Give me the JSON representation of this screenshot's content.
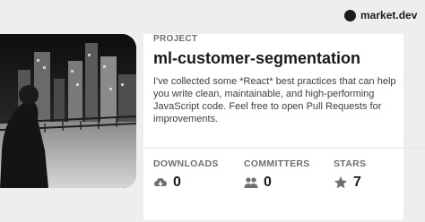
{
  "brand": {
    "name": "market.dev",
    "icon": "market-logo-icon"
  },
  "project": {
    "kicker": "PROJECT",
    "title": "ml-customer-segmentation",
    "description": "I've collected some *React* best practices that can help you write clean, maintainable, and high-performing JavaScript code. Feel free to open Pull Requests for improvements."
  },
  "stats": {
    "downloads": {
      "label": "DOWNLOADS",
      "value": "0",
      "icon": "cloud-download-icon"
    },
    "committers": {
      "label": "COMMITTERS",
      "value": "0",
      "icon": "users-icon"
    },
    "stars": {
      "label": "STARS",
      "value": "7",
      "icon": "star-icon"
    }
  },
  "colors": {
    "background": "#eeeeee",
    "card": "#ffffff",
    "text": "#1a1a1a",
    "muted": "#6f6f6f"
  }
}
